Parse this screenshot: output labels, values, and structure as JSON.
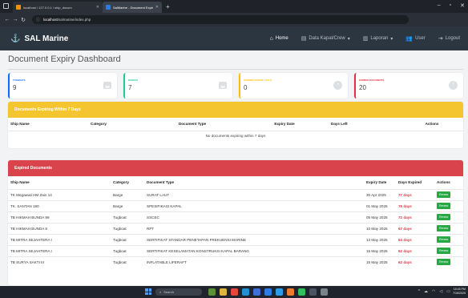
{
  "browser": {
    "tabs": [
      {
        "label": "localhost / 127.0.0.1 / ship_docum",
        "active": false
      },
      {
        "label": "SalMarine - Document Expiry Ke",
        "active": true
      }
    ],
    "address": {
      "host": "localhost",
      "path": "/salmarine/index.php"
    }
  },
  "navbar": {
    "brand": "SAL Marine",
    "menu": [
      {
        "label": "Home",
        "icon": "home-icon",
        "active": true
      },
      {
        "label": "Data Kapal/Crew",
        "icon": "database-icon",
        "dropdown": true
      },
      {
        "label": "Laporan",
        "icon": "chart-icon",
        "dropdown": true
      },
      {
        "label": "User",
        "icon": "users-icon"
      },
      {
        "label": "Logout",
        "icon": "logout-icon"
      }
    ]
  },
  "page_title": "Document Expiry Dashboard",
  "stats": [
    {
      "label": "Tugboats",
      "value": "9",
      "color": "#0d6efd"
    },
    {
      "label": "Barges",
      "value": "7",
      "color": "#20c997"
    },
    {
      "label": "Expiring Within 7 Days",
      "value": "0",
      "color": "#ffc107"
    },
    {
      "label": "Expired Documents",
      "value": "20",
      "color": "#dc3545"
    }
  ],
  "expiring": {
    "title": "Documents Expiring Within 7 Days",
    "columns": [
      "Ship Name",
      "Category",
      "Document Type",
      "Expiry Date",
      "Days Left",
      "Actions"
    ],
    "empty_message": "No documents expiring within 7 days"
  },
  "expired": {
    "title": "Expired Documents",
    "columns": [
      "Ship Name",
      "Category",
      "Document Type",
      "Expiry Date",
      "Days Expired",
      "Actions"
    ],
    "action_label": "Renew",
    "rows": [
      {
        "ship": "TK Megawati HM Zain 14",
        "category": "Barge",
        "doc": "SURAT LAUT",
        "expiry": "30 Apr 2025",
        "days": "77 days"
      },
      {
        "ship": "TK. SANTAN 180",
        "category": "Barge",
        "doc": "SPESIFIKASI KAPAL",
        "expiry": "01 May 2025",
        "days": "76 days"
      },
      {
        "ship": "TB HIKMAH BUNDA 99",
        "category": "Tugboat",
        "doc": "SSCEC",
        "expiry": "05 May 2025",
        "days": "72 days"
      },
      {
        "ship": "TB HIKMAH BUNDA 8",
        "category": "Tugboat",
        "doc": "RPT",
        "expiry": "10 May 2025",
        "days": "67 days"
      },
      {
        "ship": "TB MITRA SEJAHTERA I",
        "category": "Tugboat",
        "doc": "SERTIFIKAT STANDAR PENETAPAN FREKUENSI MARINE",
        "expiry": "13 May 2025",
        "days": "64 days"
      },
      {
        "ship": "TB MITRA SEJAHTERA I",
        "category": "Tugboat",
        "doc": "SERTIFIKAT KESELAMATAN KONSTRUKSI KAPAL BARANG",
        "expiry": "15 May 2025",
        "days": "62 days"
      },
      {
        "ship": "TB SURYA SAKTI III",
        "category": "Tugboat",
        "doc": "INFLATABLE LIFERAFT",
        "expiry": "15 May 2025",
        "days": "62 days"
      }
    ]
  },
  "taskbar": {
    "search_label": "Search",
    "clock_time": "18:45 PM",
    "clock_date": "7/16/2025"
  }
}
